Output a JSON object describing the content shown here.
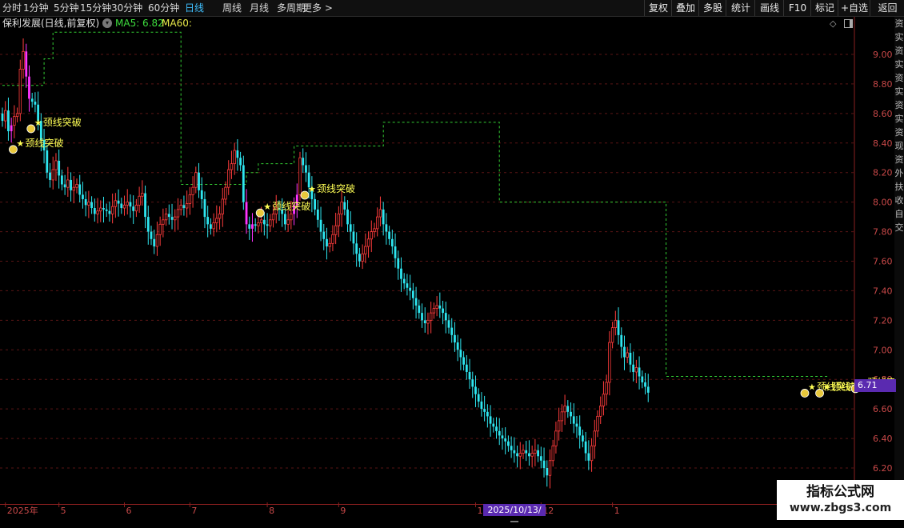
{
  "toolbar": {
    "periods": [
      "分时",
      "1分钟",
      "5分钟",
      "15分钟",
      "30分钟",
      "60分钟",
      "日线",
      "周线",
      "月线",
      "多周期",
      "更多 >"
    ],
    "active_period": "日线",
    "tools": [
      "复权",
      "叠加",
      "多股",
      "统计",
      "画线",
      "F10",
      "标记",
      "+自选",
      "返回"
    ]
  },
  "info": {
    "stock_name": "保利发展(日线,前复权)",
    "ma5_label": "MA5: 6.82",
    "ma60_label": "MA60:"
  },
  "right_panel_chars": [
    "资",
    "实",
    "资",
    "实",
    "资",
    "实",
    "资",
    "实",
    "资",
    "现",
    "资",
    "外",
    "扶",
    "收",
    "自",
    "交"
  ],
  "last_price_tag": "6.71",
  "date_marker": "2025/10/13/一",
  "watermark": {
    "title": "指标公式网",
    "url": "www.zbgs3.com"
  },
  "colors": {
    "up": "#ff3c3c",
    "down": "#2ee6f0",
    "ma60": "#33cc33",
    "signal_text": "#ffff55",
    "highlight": "#ff33ff"
  },
  "chart_data": {
    "type": "candlestick",
    "y_axis": {
      "min": 6.2,
      "max": 9.0,
      "ticks": [
        "6.20",
        "6.40",
        "6.60",
        "6.80",
        "7.00",
        "7.20",
        "7.40",
        "7.60",
        "7.80",
        "8.00",
        "8.20",
        "8.40",
        "8.60",
        "8.80",
        "9.00"
      ]
    },
    "x_labels": [
      {
        "label": "2025年",
        "index": 1
      },
      {
        "label": "5",
        "index": 19
      },
      {
        "label": "6",
        "index": 41
      },
      {
        "label": "7",
        "index": 63
      },
      {
        "label": "8",
        "index": 89
      },
      {
        "label": "9",
        "index": 113
      },
      {
        "label": "1",
        "index": 159
      },
      {
        "label": "12",
        "index": 181
      },
      {
        "label": "1",
        "index": 205
      }
    ],
    "closes": [
      8.55,
      8.62,
      8.48,
      8.52,
      8.58,
      8.6,
      8.9,
      9.02,
      8.85,
      8.7,
      8.68,
      8.66,
      8.55,
      8.42,
      8.35,
      8.2,
      8.15,
      8.22,
      8.28,
      8.18,
      8.12,
      8.1,
      8.15,
      8.08,
      8.1,
      8.12,
      8.05,
      8.02,
      7.98,
      8.0,
      7.96,
      7.92,
      7.94,
      7.96,
      7.95,
      7.94,
      7.92,
      7.97,
      8.01,
      7.99,
      7.96,
      7.98,
      8.0,
      7.97,
      7.94,
      7.98,
      8.04,
      8.06,
      7.9,
      7.8,
      7.75,
      7.7,
      7.78,
      7.85,
      7.88,
      7.92,
      7.9,
      7.88,
      7.9,
      7.95,
      7.98,
      7.96,
      7.99,
      8.05,
      8.1,
      8.2,
      8.08,
      8.02,
      7.9,
      7.85,
      7.82,
      7.86,
      7.89,
      7.92,
      8.02,
      8.1,
      8.22,
      8.26,
      8.35,
      8.3,
      8.25,
      8.0,
      7.85,
      7.82,
      7.85,
      7.84,
      7.86,
      7.88,
      7.85,
      7.84,
      7.88,
      7.92,
      7.96,
      7.95,
      7.92,
      7.85,
      7.88,
      7.92,
      7.98,
      8.05,
      8.3,
      8.25,
      8.2,
      8.1,
      8.02,
      7.95,
      7.88,
      7.8,
      7.75,
      7.7,
      7.72,
      7.78,
      7.84,
      7.92,
      8.0,
      7.95,
      7.85,
      7.8,
      7.72,
      7.65,
      7.6,
      7.65,
      7.7,
      7.75,
      7.8,
      7.82,
      7.9,
      7.95,
      7.85,
      7.8,
      7.75,
      7.7,
      7.62,
      7.55,
      7.48,
      7.45,
      7.42,
      7.4,
      7.35,
      7.3,
      7.25,
      7.2,
      7.18,
      7.2,
      7.25,
      7.28,
      7.3,
      7.28,
      7.25,
      7.2,
      7.15,
      7.1,
      7.05,
      7.0,
      6.95,
      6.9,
      6.85,
      6.8,
      6.75,
      6.7,
      6.65,
      6.6,
      6.58,
      6.55,
      6.5,
      6.48,
      6.45,
      6.42,
      6.4,
      6.38,
      6.35,
      6.32,
      6.3,
      6.28,
      6.3,
      6.32,
      6.3,
      6.28,
      6.3,
      6.32,
      6.28,
      6.25,
      6.2,
      6.15,
      6.25,
      6.35,
      6.45,
      6.52,
      6.58,
      6.62,
      6.58,
      6.55,
      6.5,
      6.48,
      6.42,
      6.38,
      6.3,
      6.25,
      6.35,
      6.45,
      6.55,
      6.62,
      6.7,
      6.78,
      7.05,
      7.15,
      7.2,
      7.1,
      7.02,
      6.95,
      6.98,
      6.9,
      6.85,
      6.88,
      6.82,
      6.78,
      6.75,
      6.71
    ],
    "ma60": [
      [
        0,
        8.79
      ],
      [
        14,
        8.79
      ],
      [
        14,
        8.97
      ],
      [
        17,
        8.97
      ],
      [
        17,
        9.15
      ],
      [
        60,
        9.15
      ],
      [
        60,
        8.12
      ],
      [
        82,
        8.12
      ],
      [
        82,
        8.2
      ],
      [
        86,
        8.2
      ],
      [
        86,
        8.26
      ],
      [
        98,
        8.26
      ],
      [
        98,
        8.38
      ],
      [
        128,
        8.38
      ],
      [
        128,
        8.54
      ],
      [
        167,
        8.54
      ],
      [
        167,
        8.0
      ],
      [
        223,
        8.0
      ],
      [
        223,
        6.82
      ],
      [
        278,
        6.82
      ]
    ],
    "signals": [
      {
        "index": 2,
        "price": 8.4,
        "label": "颈线突破"
      },
      {
        "index": 8,
        "price": 8.54,
        "label": "颈线突破"
      },
      {
        "index": 85,
        "price": 7.97,
        "label": "颈线突破"
      },
      {
        "index": 100,
        "price": 8.09,
        "label": "颈线突破"
      },
      {
        "index": 268,
        "price": 6.75,
        "label": "颈线突破"
      },
      {
        "index": 273,
        "price": 6.75,
        "label": "颈线突破"
      },
      {
        "index": 285,
        "price": 6.78,
        "label": "颈线突破"
      }
    ]
  }
}
